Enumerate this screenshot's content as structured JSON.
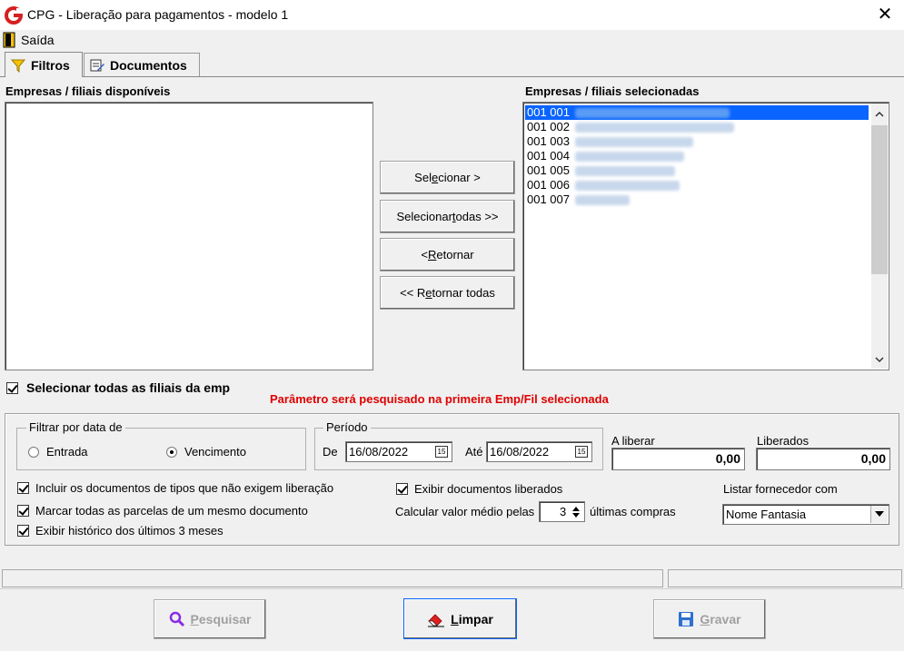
{
  "window": {
    "title": "CPG - Liberação para pagamentos - modelo 1",
    "close_glyph": "✕"
  },
  "menu": {
    "exit_label": "Saída"
  },
  "tabs": [
    {
      "label": "Filtros",
      "icon": "funnel-icon",
      "active": true
    },
    {
      "label": "Documentos",
      "icon": "notepad-icon",
      "active": false
    }
  ],
  "available": {
    "label": "Empresas / filiais disponíveis",
    "items": []
  },
  "selected": {
    "label": "Empresas / filiais selecionadas",
    "items": [
      "001 001",
      "001 002",
      "001 003",
      "001 004",
      "001 005",
      "001 006",
      "001 007"
    ]
  },
  "transfer_buttons": {
    "select": {
      "pre": "Sel",
      "u": "e",
      "post": "cionar >"
    },
    "select_all": {
      "pre": "Selecionar ",
      "u": "t",
      "post": "odas >>"
    },
    "return": {
      "pre": "< ",
      "u": "R",
      "post": "etornar"
    },
    "return_all": {
      "pre": "<< R",
      "u": "e",
      "post": "tornar todas"
    }
  },
  "select_all_branches": {
    "label": "Selecionar todas as filiais da emp",
    "checked": true
  },
  "warning": "Parâmetro será pesquisado na primeira Emp/Fil selecionada",
  "filter_date": {
    "legend": "Filtrar por data de",
    "options": [
      {
        "label": "Entrada",
        "checked": false
      },
      {
        "label": "Vencimento",
        "checked": true
      }
    ]
  },
  "period": {
    "legend": "Período",
    "from_label": "De",
    "from_value": "16/08/2022",
    "to_label": "Até",
    "to_value": "16/08/2022",
    "cal_glyph": "15"
  },
  "totals": {
    "to_release": {
      "label": "A liberar",
      "value": "0,00"
    },
    "released": {
      "label": "Liberados",
      "value": "0,00"
    }
  },
  "options": {
    "include_docs": {
      "label": "Incluir os documentos de tipos que não exigem liberação",
      "checked": true
    },
    "mark_all": {
      "label": "Marcar todas as parcelas de um mesmo documento",
      "checked": true
    },
    "show_history": {
      "label": "Exibir histórico dos últimos 3 meses",
      "checked": true
    },
    "show_released": {
      "label": "Exibir documentos liberados",
      "checked": true
    }
  },
  "average": {
    "pre_label": "Calcular valor médio pelas",
    "value": "3",
    "post_label": "últimas compras"
  },
  "supplier": {
    "label": "Listar fornecedor com",
    "value": "Nome Fantasia"
  },
  "actions": {
    "search": {
      "u": "P",
      "post": "esquisar",
      "enabled": false
    },
    "clear": {
      "u": "L",
      "post": "impar",
      "enabled": true
    },
    "save": {
      "u": "G",
      "post": "ravar",
      "enabled": false
    }
  },
  "colors": {
    "selection": "#0a64ff",
    "warning": "#e00000",
    "brand": "#d42020"
  }
}
